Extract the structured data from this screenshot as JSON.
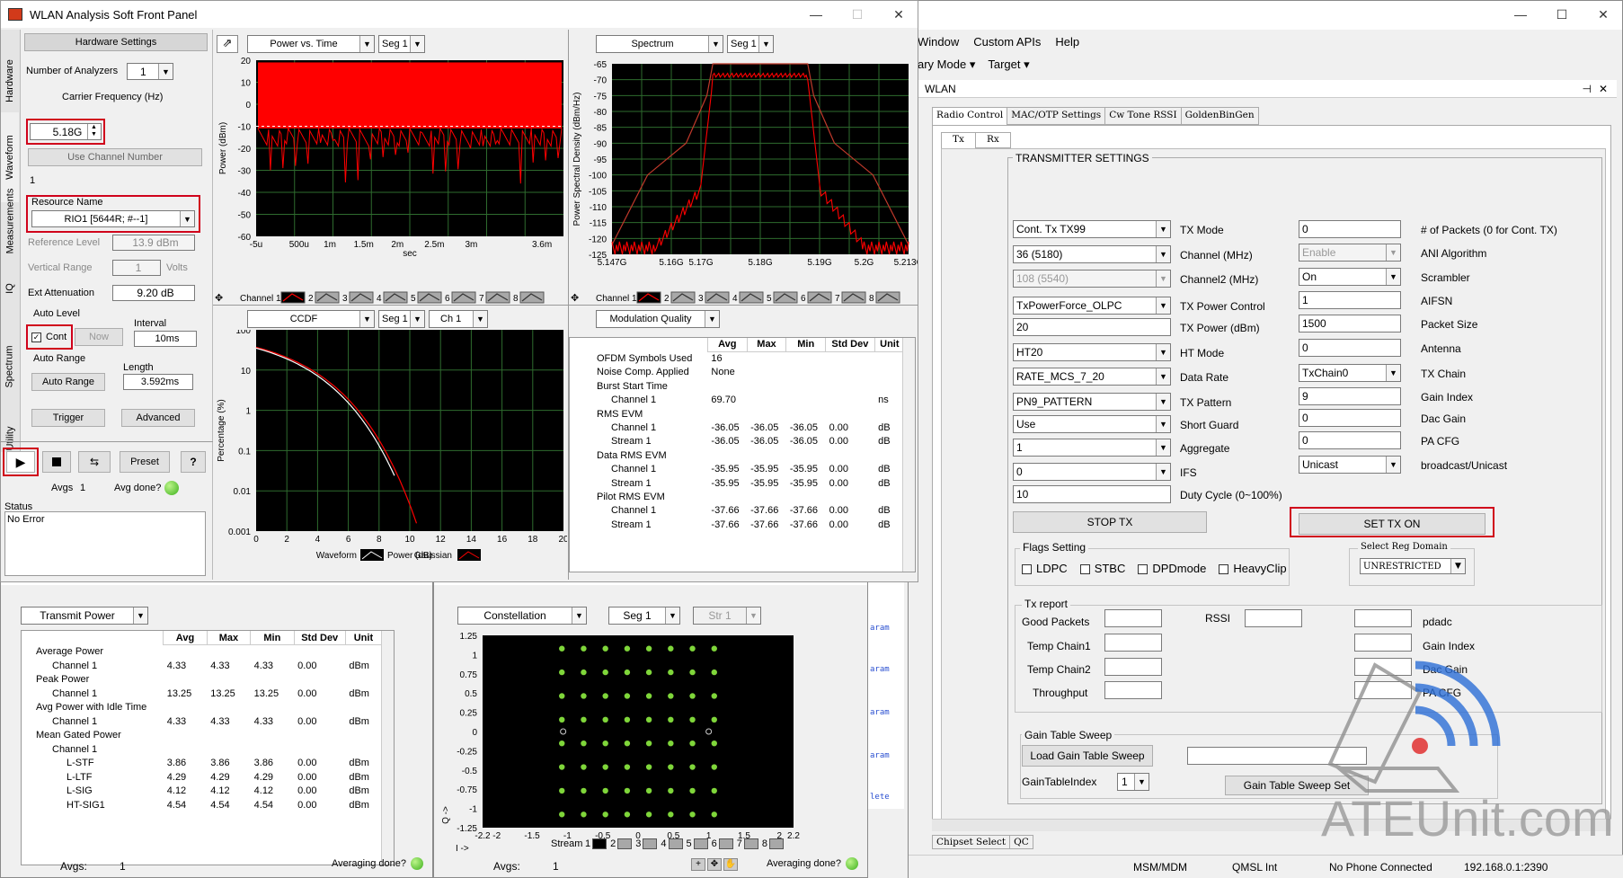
{
  "sfp": {
    "title": "WLAN Analysis Soft Front Panel",
    "hardware_settings": "Hardware Settings",
    "side_tabs": [
      "Hardware",
      "Waveform",
      "Measurements",
      "IQ",
      "Spectrum",
      "Utility"
    ],
    "num_analyzers_label": "Number of Analyzers",
    "num_analyzers": "1",
    "carrier_freq_label": "Carrier Frequency (Hz)",
    "carrier_freq": "5.18G",
    "use_channel_number": "Use Channel Number",
    "channel_number": "1",
    "resource_name_label": "Resource Name",
    "resource_name": "RIO1 [5644R; #--1]",
    "ref_level_label": "Reference Level",
    "ref_level": "13.9 dBm",
    "vert_range_label": "Vertical Range",
    "vert_range": "1",
    "vert_unit": "Volts",
    "ext_atten_label": "Ext Attenuation",
    "ext_atten": "9.20 dB",
    "auto_level": "Auto Level",
    "interval_label": "Interval",
    "cont": "Cont",
    "now": "Now",
    "interval": "10ms",
    "auto_range": "Auto Range",
    "length_label": "Length",
    "auto_range_btn": "Auto Range",
    "length": "3.592ms",
    "trigger": "Trigger",
    "advanced": "Advanced",
    "preset": "Preset",
    "help": "?",
    "avgs_label": "Avgs",
    "avgs": "1",
    "avg_done": "Avg done?",
    "status_label": "Status",
    "status": "No Error",
    "pvt": {
      "dropdown": "Power vs. Time",
      "seg": "Seg 1",
      "ylabel": "Power (dBm)",
      "xlabel": "sec",
      "yticks": [
        "20",
        "10",
        "0",
        "-10",
        "-20",
        "-30",
        "-40",
        "-50",
        "-60"
      ],
      "xticks": [
        "-5u",
        "500u",
        "1m",
        "1.5m",
        "2m",
        "2.5m",
        "3m",
        "3.6m"
      ]
    },
    "spectrum": {
      "dropdown": "Spectrum",
      "seg": "Seg 1",
      "ylabel": "Power Spectral Density (dBm/Hz)",
      "yticks": [
        "-65",
        "-70",
        "-75",
        "-80",
        "-85",
        "-90",
        "-95",
        "-100",
        "-105",
        "-110",
        "-115",
        "-120",
        "-125"
      ],
      "xticks": [
        "5.147G",
        "5.16G",
        "5.17G",
        "5.18G",
        "5.19G",
        "5.2G",
        "5.213G"
      ]
    },
    "channel_legend": [
      "Channel 1",
      "2",
      "3",
      "4",
      "5",
      "6",
      "7",
      "8"
    ],
    "ccdf": {
      "dropdown": "CCDF",
      "seg": "Seg 1",
      "ch": "Ch 1",
      "ylabel": "Percentage (%)",
      "xlabel": "Power (dB)",
      "yticks": [
        "100",
        "10",
        "1",
        "0.1",
        "0.01",
        "0.001"
      ],
      "xticks": [
        "0",
        "2",
        "4",
        "6",
        "8",
        "10",
        "12",
        "14",
        "16",
        "18",
        "20"
      ],
      "legend_waveform": "Waveform",
      "legend_gaussian": "Gaussian"
    },
    "modq": {
      "dropdown": "Modulation Quality",
      "headers": [
        "Avg",
        "Max",
        "Min",
        "Std Dev",
        "Unit"
      ],
      "rows": [
        {
          "name": "OFDM Symbols Used",
          "avg": "16",
          "max": "",
          "min": "",
          "sd": "",
          "unit": ""
        },
        {
          "name": "Noise Comp. Applied",
          "avg": "None",
          "max": "",
          "min": "",
          "sd": "",
          "unit": ""
        },
        {
          "name": "Burst Start Time",
          "avg": "",
          "max": "",
          "min": "",
          "sd": "",
          "unit": ""
        },
        {
          "name": "Channel 1",
          "avg": "69.70",
          "max": "",
          "min": "",
          "sd": "",
          "unit": "ns"
        },
        {
          "name": "RMS EVM",
          "avg": "",
          "max": "",
          "min": "",
          "sd": "",
          "unit": ""
        },
        {
          "name": "Channel 1",
          "avg": "-36.05",
          "max": "-36.05",
          "min": "-36.05",
          "sd": "0.00",
          "unit": "dB"
        },
        {
          "name": "Stream 1",
          "avg": "-36.05",
          "max": "-36.05",
          "min": "-36.05",
          "sd": "0.00",
          "unit": "dB"
        },
        {
          "name": "Data RMS EVM",
          "avg": "",
          "max": "",
          "min": "",
          "sd": "",
          "unit": ""
        },
        {
          "name": "Channel 1",
          "avg": "-35.95",
          "max": "-35.95",
          "min": "-35.95",
          "sd": "0.00",
          "unit": "dB"
        },
        {
          "name": "Stream 1",
          "avg": "-35.95",
          "max": "-35.95",
          "min": "-35.95",
          "sd": "0.00",
          "unit": "dB"
        },
        {
          "name": "Pilot RMS EVM",
          "avg": "",
          "max": "",
          "min": "",
          "sd": "",
          "unit": ""
        },
        {
          "name": "Channel 1",
          "avg": "-37.66",
          "max": "-37.66",
          "min": "-37.66",
          "sd": "0.00",
          "unit": "dB"
        },
        {
          "name": "Stream 1",
          "avg": "-37.66",
          "max": "-37.66",
          "min": "-37.66",
          "sd": "0.00",
          "unit": "dB"
        }
      ]
    }
  },
  "txpower": {
    "title": "Transmit Power",
    "dropdown": "Transmit Power",
    "headers": [
      "Avg",
      "Max",
      "Min",
      "Std Dev",
      "Unit"
    ],
    "rows": [
      {
        "name": "Average Power",
        "avg": "",
        "max": "",
        "min": "",
        "sd": "",
        "unit": ""
      },
      {
        "name": "Channel 1",
        "avg": "4.33",
        "max": "4.33",
        "min": "4.33",
        "sd": "0.00",
        "unit": "dBm"
      },
      {
        "name": "Peak Power",
        "avg": "",
        "max": "",
        "min": "",
        "sd": "",
        "unit": ""
      },
      {
        "name": "Channel 1",
        "avg": "13.25",
        "max": "13.25",
        "min": "13.25",
        "sd": "0.00",
        "unit": "dBm"
      },
      {
        "name": "Avg Power with Idle Time",
        "avg": "",
        "max": "",
        "min": "",
        "sd": "",
        "unit": ""
      },
      {
        "name": "Channel 1",
        "avg": "4.33",
        "max": "4.33",
        "min": "4.33",
        "sd": "0.00",
        "unit": "dBm"
      },
      {
        "name": "Mean Gated Power",
        "avg": "",
        "max": "",
        "min": "",
        "sd": "",
        "unit": ""
      },
      {
        "name": "Channel 1",
        "avg": "",
        "max": "",
        "min": "",
        "sd": "",
        "unit": ""
      },
      {
        "name": "L-STF",
        "avg": "3.86",
        "max": "3.86",
        "min": "3.86",
        "sd": "0.00",
        "unit": "dBm"
      },
      {
        "name": "L-LTF",
        "avg": "4.29",
        "max": "4.29",
        "min": "4.29",
        "sd": "0.00",
        "unit": "dBm"
      },
      {
        "name": "L-SIG",
        "avg": "4.12",
        "max": "4.12",
        "min": "4.12",
        "sd": "0.00",
        "unit": "dBm"
      },
      {
        "name": "HT-SIG1",
        "avg": "4.54",
        "max": "4.54",
        "min": "4.54",
        "sd": "0.00",
        "unit": "dBm"
      }
    ],
    "avgs_label": "Avgs:",
    "avgs": "1",
    "avg_done": "Averaging done?"
  },
  "constellation": {
    "title": "Constellation",
    "dropdown": "Constellation",
    "seg": "Seg 1",
    "str": "Str 1",
    "yticks": [
      "1.25",
      "1",
      "0.75",
      "0.5",
      "0.25",
      "0",
      "-0.25",
      "-0.5",
      "-0.75",
      "-1",
      "-1.25"
    ],
    "xticks": [
      "-2.2",
      "-2",
      "-1.5",
      "-1",
      "-0.5",
      "0",
      "0.5",
      "1",
      "1.5",
      "2",
      "2.2"
    ],
    "xlabel": "I ->",
    "ylabel": "Q ->",
    "stream_label": "Stream",
    "streams": [
      "1",
      "2",
      "3",
      "4",
      "5",
      "6",
      "7",
      "8"
    ],
    "avgs_label": "Avgs:",
    "avgs": "1",
    "avg_done": "Averaging done?"
  },
  "qrct": {
    "menu": [
      "Window",
      "Custom APIs",
      "Help"
    ],
    "toolbar": [
      "ary Mode",
      "Target"
    ],
    "panel_title": "WLAN",
    "tabs": [
      "Radio Control",
      "MAC/OTP Settings",
      "Cw Tone RSSI",
      "GoldenBinGen"
    ],
    "subtabs": [
      "Tx",
      "Rx"
    ],
    "group_title": "TRANSMITTER SETTINGS",
    "left_fields": [
      {
        "value": "Cont. Tx TX99",
        "type": "dd",
        "label": "TX Mode"
      },
      {
        "value": "36 (5180)",
        "type": "dd",
        "label": "Channel (MHz)"
      },
      {
        "value": "108 (5540)",
        "type": "dd",
        "label": "Channel2 (MHz)"
      },
      {
        "value": "TxPowerForce_OLPC",
        "type": "dd",
        "label": "TX Power Control"
      },
      {
        "value": "20",
        "type": "in",
        "label": "TX Power (dBm)"
      },
      {
        "value": "HT20",
        "type": "dd",
        "label": "HT Mode"
      },
      {
        "value": "RATE_MCS_7_20",
        "type": "dd",
        "label": "Data Rate"
      },
      {
        "value": "PN9_PATTERN",
        "type": "dd",
        "label": "TX Pattern"
      },
      {
        "value": "Use",
        "type": "dd",
        "label": "Short Guard"
      },
      {
        "value": "1",
        "type": "dd",
        "label": "Aggregate"
      },
      {
        "value": "0",
        "type": "dd",
        "label": "IFS"
      },
      {
        "value": "10",
        "type": "in",
        "label": "Duty Cycle (0~100%)"
      }
    ],
    "right_fields": [
      {
        "value": "0",
        "type": "in",
        "label": "# of Packets (0 for Cont. TX)"
      },
      {
        "value": "Enable",
        "type": "dd",
        "label": "ANI Algorithm"
      },
      {
        "value": "On",
        "type": "dd",
        "label": "Scrambler"
      },
      {
        "value": "1",
        "type": "in",
        "label": "AIFSN"
      },
      {
        "value": "1500",
        "type": "in",
        "label": "Packet Size"
      },
      {
        "value": "0",
        "type": "in",
        "label": "Antenna"
      },
      {
        "value": "TxChain0",
        "type": "dd",
        "label": "TX Chain"
      },
      {
        "value": "9",
        "type": "in",
        "label": "Gain Index"
      },
      {
        "value": "0",
        "type": "in",
        "label": "Dac Gain"
      },
      {
        "value": "0",
        "type": "in",
        "label": "PA CFG"
      },
      {
        "value": "Unicast",
        "type": "dd",
        "label": "broadcast/Unicast"
      }
    ],
    "stop_tx": "STOP TX",
    "set_tx_on": "SET TX ON",
    "flags_title": "Flags Setting",
    "flags": [
      "LDPC",
      "STBC",
      "DPDmode",
      "HeavyClip"
    ],
    "reg_domain_title": "Select Reg Domain",
    "reg_domain": "UNRESTRICTED",
    "tx_report_title": "Tx report",
    "good_packets": "Good Packets",
    "rssi": "RSSI",
    "temp_chain1": "Temp Chain1",
    "temp_chain2": "Temp Chain2",
    "throughput": "Throughput",
    "pdadc": "pdadc",
    "gain_index": "Gain Index",
    "dac_gain": "Dac Gain",
    "pa_cfg": "PA CFG",
    "gts_title": "Gain Table Sweep",
    "load_gts": "Load Gain Table Sweep",
    "gain_table_index_label": "GainTableIndex",
    "gain_table_index": "1",
    "gts_set": "Gain Table Sweep Set",
    "bottom_tabs": [
      "Chipset Select",
      "QC"
    ],
    "status": [
      "MSM/MDM",
      "QMSL Int",
      "No Phone Connected",
      "192.168.0.1:2390"
    ],
    "aram": [
      "aram",
      "aram",
      "aram",
      "aram",
      "lete"
    ]
  },
  "watermark": "ATEUnit.com",
  "colors": {
    "red": "#ff0000",
    "grid": "#2e6b2e",
    "const_point": "#7fd63a",
    "highlight": "#d0021b"
  }
}
